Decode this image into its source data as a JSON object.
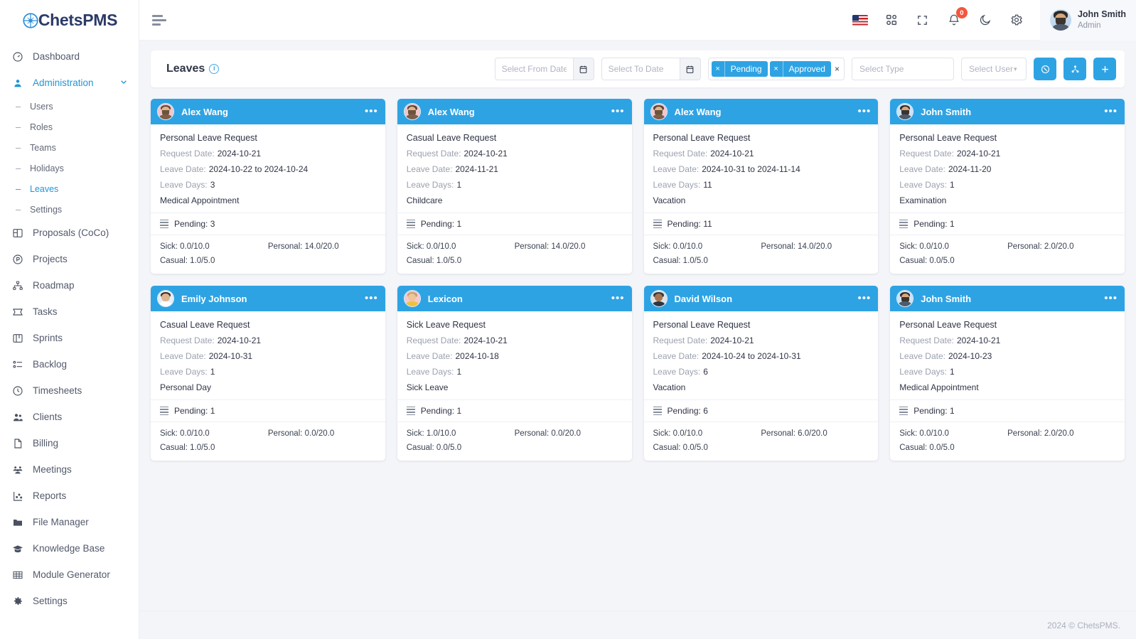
{
  "brand": {
    "name": "ChetsPMS",
    "logo_icon": "compass-logo-icon"
  },
  "sidebar": {
    "items": [
      {
        "label": "Dashboard",
        "icon": "gauge-icon",
        "active": false
      },
      {
        "label": "Administration",
        "icon": "user-circle-icon",
        "active": true,
        "expandable": true
      },
      {
        "label": "Proposals (CoCo)",
        "icon": "layout-icon",
        "active": false
      },
      {
        "label": "Projects",
        "icon": "projects-circle-icon",
        "active": false
      },
      {
        "label": "Roadmap",
        "icon": "hierarchy-icon",
        "active": false
      },
      {
        "label": "Tasks",
        "icon": "ticket-icon",
        "active": false
      },
      {
        "label": "Sprints",
        "icon": "kanban-icon",
        "active": false
      },
      {
        "label": "Backlog",
        "icon": "list-check-icon",
        "active": false
      },
      {
        "label": "Timesheets",
        "icon": "clock-icon",
        "active": false
      },
      {
        "label": "Clients",
        "icon": "users-icon",
        "active": false
      },
      {
        "label": "Billing",
        "icon": "file-icon",
        "active": false
      },
      {
        "label": "Meetings",
        "icon": "people-group-icon",
        "active": false
      },
      {
        "label": "Reports",
        "icon": "chart-icon",
        "active": false
      },
      {
        "label": "File Manager",
        "icon": "folder-icon",
        "active": false
      },
      {
        "label": "Knowledge Base",
        "icon": "graduation-cap-icon",
        "active": false
      },
      {
        "label": "Module Generator",
        "icon": "grid-table-icon",
        "active": false
      },
      {
        "label": "Settings",
        "icon": "gear-icon",
        "active": false
      }
    ],
    "sub_items": [
      {
        "label": "Users",
        "active": false
      },
      {
        "label": "Roles",
        "active": false
      },
      {
        "label": "Teams",
        "active": false
      },
      {
        "label": "Holidays",
        "active": false
      },
      {
        "label": "Leaves",
        "active": true
      },
      {
        "label": "Settings",
        "active": false
      }
    ]
  },
  "topbar": {
    "menu_toggle_icon": "hamburger-menu-icon",
    "icons": [
      {
        "name": "flag-us-icon"
      },
      {
        "name": "apps-grid-icon"
      },
      {
        "name": "fullscreen-icon"
      },
      {
        "name": "bell-icon",
        "badge": "0"
      },
      {
        "name": "moon-icon"
      },
      {
        "name": "gear-icon"
      }
    ],
    "profile": {
      "name": "John Smith",
      "role": "Admin",
      "avatar": "avatar-john-smith"
    }
  },
  "filterbar": {
    "title": "Leaves",
    "info_icon": "info-icon",
    "from_date": {
      "placeholder": "Select From Date",
      "value": "",
      "icon": "calendar-icon"
    },
    "to_date": {
      "placeholder": "Select To Date",
      "value": "",
      "icon": "calendar-icon"
    },
    "status_tags": [
      "Pending",
      "Approved"
    ],
    "clear_all_label": "×",
    "select_type": {
      "placeholder": "Select Type"
    },
    "select_user": {
      "placeholder": "Select User"
    },
    "buttons": [
      {
        "name": "reset-filter-button",
        "glyph": "⊗"
      },
      {
        "name": "assign-user-button",
        "glyph": "⚷"
      },
      {
        "name": "add-leave-button",
        "glyph": "+"
      }
    ],
    "accent_color": "#2ea3e4"
  },
  "cards": [
    {
      "name": "Alex Wang",
      "avatar_type": "man-beard-pink",
      "title": "Personal Leave Request",
      "request_date_label": "Request Date:",
      "request_date": "2024-10-21",
      "leave_date_label": "Leave Date:",
      "leave_date": "2024-10-22 to 2024-10-24",
      "leave_days_label": "Leave Days:",
      "leave_days": "3",
      "reason": "Medical Appointment",
      "status": "Pending: 3",
      "sick": "Sick: 0.0/10.0",
      "personal": "Personal: 14.0/20.0",
      "casual": "Casual: 1.0/5.0"
    },
    {
      "name": "Alex Wang",
      "avatar_type": "man-beard-pink",
      "title": "Casual Leave Request",
      "request_date_label": "Request Date:",
      "request_date": "2024-10-21",
      "leave_date_label": "Leave Date:",
      "leave_date": "2024-11-21",
      "leave_days_label": "Leave Days:",
      "leave_days": "1",
      "reason": "Childcare",
      "status": "Pending: 1",
      "sick": "Sick: 0.0/10.0",
      "personal": "Personal: 14.0/20.0",
      "casual": "Casual: 1.0/5.0"
    },
    {
      "name": "Alex Wang",
      "avatar_type": "man-beard-pink",
      "title": "Personal Leave Request",
      "request_date_label": "Request Date:",
      "request_date": "2024-10-21",
      "leave_date_label": "Leave Date:",
      "leave_date": "2024-10-31 to 2024-11-14",
      "leave_days_label": "Leave Days:",
      "leave_days": "11",
      "reason": "Vacation",
      "status": "Pending: 11",
      "sick": "Sick: 0.0/10.0",
      "personal": "Personal: 14.0/20.0",
      "casual": "Casual: 1.0/5.0"
    },
    {
      "name": "John Smith",
      "avatar_type": "man-blue",
      "title": "Personal Leave Request",
      "request_date_label": "Request Date:",
      "request_date": "2024-10-21",
      "leave_date_label": "Leave Date:",
      "leave_date": "2024-11-20",
      "leave_days_label": "Leave Days:",
      "leave_days": "1",
      "reason": "Examination",
      "status": "Pending: 1",
      "sick": "Sick: 0.0/10.0",
      "personal": "Personal: 2.0/20.0",
      "casual": "Casual: 0.0/5.0"
    },
    {
      "name": "Emily Johnson",
      "avatar_type": "woman-dark",
      "title": "Casual Leave Request",
      "request_date_label": "Request Date:",
      "request_date": "2024-10-21",
      "leave_date_label": "Leave Date:",
      "leave_date": "2024-10-31",
      "leave_days_label": "Leave Days:",
      "leave_days": "1",
      "reason": "Personal Day",
      "status": "Pending: 1",
      "sick": "Sick: 0.0/10.0",
      "personal": "Personal: 0.0/20.0",
      "casual": "Casual: 1.0/5.0"
    },
    {
      "name": "Lexicon",
      "avatar_type": "woman-blonde",
      "title": "Sick Leave Request",
      "request_date_label": "Request Date:",
      "request_date": "2024-10-21",
      "leave_date_label": "Leave Date:",
      "leave_date": "2024-10-18",
      "leave_days_label": "Leave Days:",
      "leave_days": "1",
      "reason": "Sick Leave",
      "status": "Pending: 1",
      "sick": "Sick: 1.0/10.0",
      "personal": "Personal: 0.0/20.0",
      "casual": "Casual: 0.0/5.0"
    },
    {
      "name": "David Wilson",
      "avatar_type": "man-gray",
      "title": "Personal Leave Request",
      "request_date_label": "Request Date:",
      "request_date": "2024-10-21",
      "leave_date_label": "Leave Date:",
      "leave_date": "2024-10-24 to 2024-10-31",
      "leave_days_label": "Leave Days:",
      "leave_days": "6",
      "reason": "Vacation",
      "status": "Pending: 6",
      "sick": "Sick: 0.0/10.0",
      "personal": "Personal: 6.0/20.0",
      "casual": "Casual: 0.0/5.0"
    },
    {
      "name": "John Smith",
      "avatar_type": "man-blue",
      "title": "Personal Leave Request",
      "request_date_label": "Request Date:",
      "request_date": "2024-10-21",
      "leave_date_label": "Leave Date:",
      "leave_date": "2024-10-23",
      "leave_days_label": "Leave Days:",
      "leave_days": "1",
      "reason": "Medical Appointment",
      "status": "Pending: 1",
      "sick": "Sick: 0.0/10.0",
      "personal": "Personal: 2.0/20.0",
      "casual": "Casual: 0.0/5.0"
    }
  ],
  "footer": {
    "text": "2024 © ChetsPMS."
  }
}
